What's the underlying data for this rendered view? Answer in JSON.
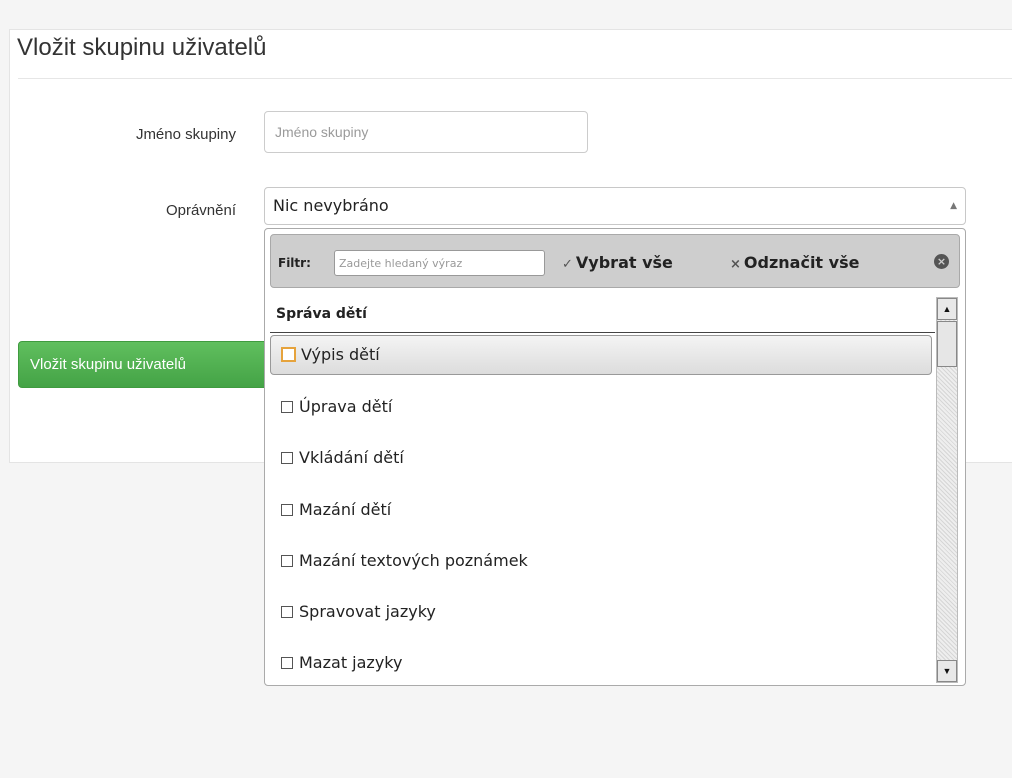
{
  "page": {
    "title": "Vložit skupinu uživatelů"
  },
  "form": {
    "name_label": "Jméno skupiny",
    "name_placeholder": "Jméno skupiny",
    "name_value": "",
    "permissions_label": "Oprávnění",
    "permissions_selected": "Nic nevybráno",
    "submit_label": "Vložit skupinu uživatelů"
  },
  "dropdown": {
    "filter_label": "Filtr:",
    "filter_placeholder": "Zadejte hledaný výraz",
    "select_all_icon": "✓",
    "select_all_label": "Vybrat vše",
    "deselect_all_icon": "×",
    "deselect_all_label": "Odznačit vše",
    "group_header": "Správa dětí",
    "options": [
      {
        "label": "Výpis dětí",
        "checked": false,
        "highlighted": true
      },
      {
        "label": "Úprava dětí",
        "checked": false,
        "highlighted": false
      },
      {
        "label": "Vkládání dětí",
        "checked": false,
        "highlighted": false
      },
      {
        "label": "Mazání dětí",
        "checked": false,
        "highlighted": false
      },
      {
        "label": "Mazání textových poznámek",
        "checked": false,
        "highlighted": false
      },
      {
        "label": "Spravovat jazyky",
        "checked": false,
        "highlighted": false
      },
      {
        "label": "Mazat jazyky",
        "checked": false,
        "highlighted": false
      }
    ]
  },
  "colors": {
    "primary_button": "#4cae4c",
    "highlight_checkbox": "#e6a33c",
    "filter_bar": "#cecece"
  }
}
